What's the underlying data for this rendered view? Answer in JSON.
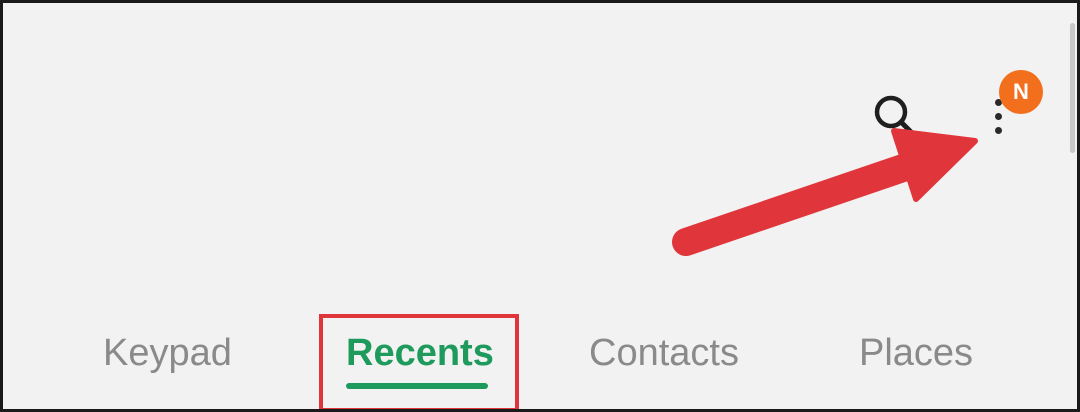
{
  "toolbar": {
    "search_icon": "search-icon",
    "more_icon": "more-vert-icon",
    "badge": {
      "text": "N",
      "color": "#f26f1d"
    }
  },
  "tabs": [
    {
      "label": "Keypad",
      "active": false
    },
    {
      "label": "Recents",
      "active": true
    },
    {
      "label": "Contacts",
      "active": false
    },
    {
      "label": "Places",
      "active": false
    }
  ],
  "colors": {
    "background": "#f2f2f2",
    "active_tab": "#1e9a5c",
    "inactive_tab": "#8a8a8a",
    "annotation": "#e0353a"
  }
}
